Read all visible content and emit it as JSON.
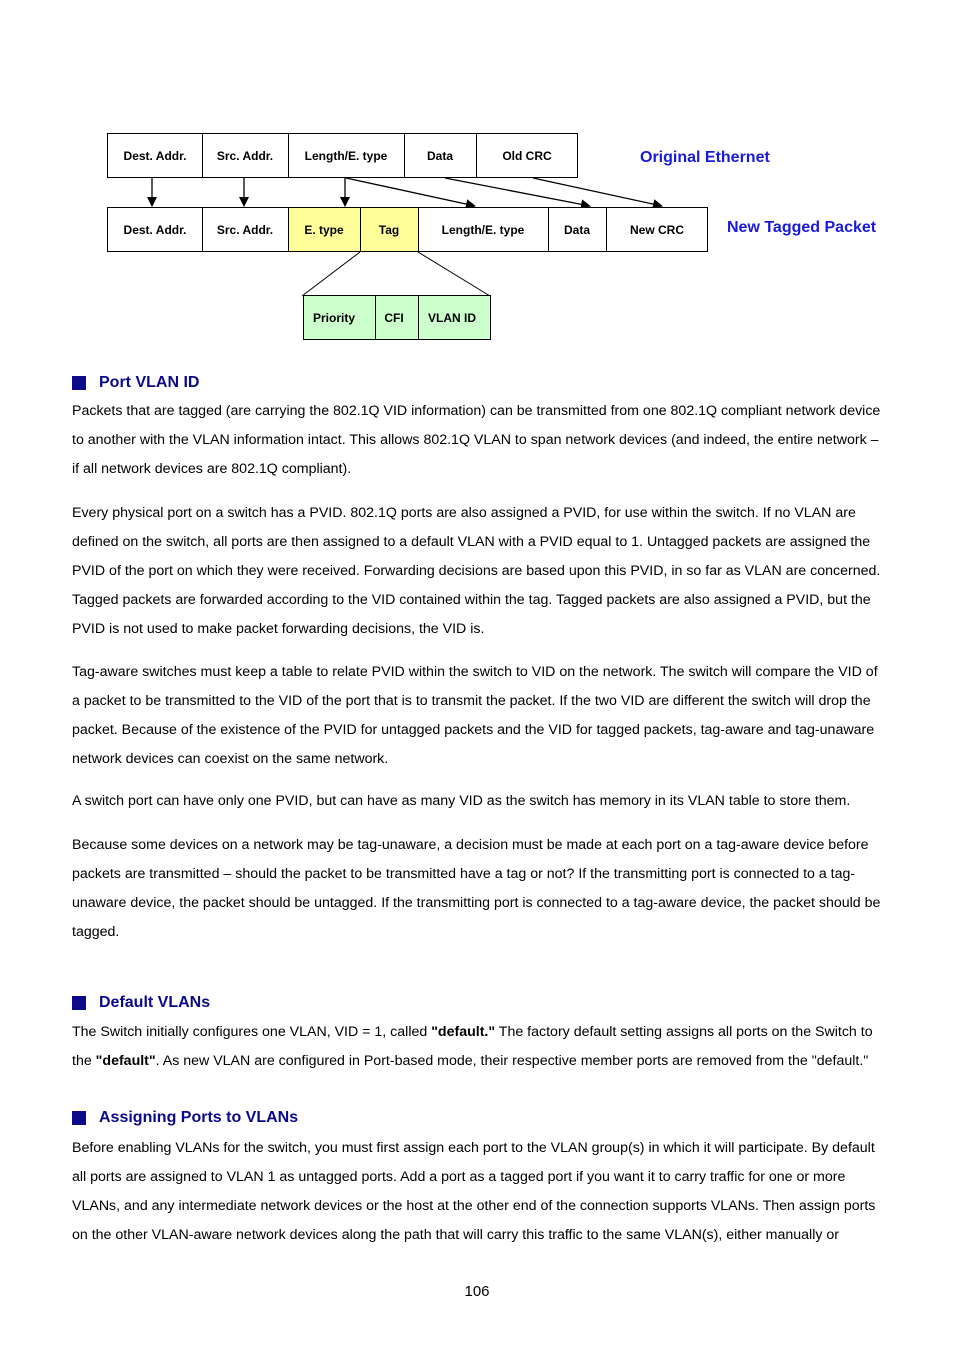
{
  "diagram": {
    "original_label": "Original Ethernet",
    "tagged_label": "New Tagged Packet",
    "original_fields": [
      "Dest. Addr.",
      "Src. Addr.",
      "Length/E. type",
      "Data",
      "Old CRC"
    ],
    "tagged_fields": [
      "Dest. Addr.",
      "Src. Addr.",
      "E. type",
      "Tag",
      "Length/E. type",
      "Data",
      "New CRC"
    ],
    "tag_fields": [
      "Priority",
      "CFI",
      "VLAN ID"
    ],
    "colors": {
      "highlight_yellow": "#ffff99",
      "tag_green": "#ccffcc",
      "label_blue": "#1a1adb",
      "heading_navy": "#0a0a8a"
    }
  },
  "sections": {
    "port_vlan_id": {
      "title": "Port VLAN ID",
      "paragraphs": [
        "Packets that are tagged (are carrying the 802.1Q VID information) can be transmitted from one 802.1Q compliant network device to another with the VLAN information intact. This allows 802.1Q VLAN to span network devices (and indeed, the entire network – if all network devices are 802.1Q compliant).",
        "Every physical port on a switch has a PVID. 802.1Q ports are also assigned a PVID, for use within the switch. If no VLAN are defined on the switch, all ports are then assigned to a default VLAN with a PVID equal to 1. Untagged packets are assigned the PVID of the port on which they were received. Forwarding decisions are based upon this PVID, in so far as VLAN are concerned. Tagged packets are forwarded according to the VID contained within the tag. Tagged packets are also assigned a PVID, but the PVID is not used to make packet forwarding decisions, the VID is.",
        "Tag-aware switches must keep a table to relate PVID within the switch to VID on the network. The switch will compare the VID of a packet to be transmitted to the VID of the port that is to transmit the packet. If the two VID are different the switch will drop the packet. Because of the existence of the PVID for untagged packets and the VID for tagged packets, tag-aware and tag-unaware network devices can coexist on the same network.",
        "A switch port can have only one PVID, but can have as many VID as the switch has memory in its VLAN table to store them.",
        "Because some devices on a network may be tag-unaware, a decision must be made at each port on a tag-aware device before packets are transmitted – should the packet to be transmitted have a tag or not? If the transmitting port is connected to a tag-unaware device, the packet should be untagged. If the transmitting port is connected to a tag-aware device, the packet should be tagged."
      ]
    },
    "default_vlans": {
      "title": "Default VLANs",
      "p1_a": "The Switch initially configures one VLAN, VID = 1, called ",
      "p1_b": "\"default.\"",
      "p1_c": " The factory default setting assigns all ports on the Switch to the ",
      "p1_d": "\"default\"",
      "p1_e": ". As new VLAN are configured in Port-based mode, their respective member ports are removed from the \"default.\""
    },
    "assigning_ports": {
      "title": "Assigning Ports to VLANs",
      "paragraph": "Before enabling VLANs for the switch, you must first assign each port to the VLAN group(s) in which it will participate. By default all ports are assigned to VLAN 1 as untagged ports. Add a port as a tagged port if you want it to carry traffic for one or more VLANs, and any intermediate network devices or the host at the other end of the connection supports VLANs. Then assign ports on the other VLAN-aware network devices along the path that will carry this traffic to the same VLAN(s), either manually or"
    }
  },
  "page_number": "106"
}
